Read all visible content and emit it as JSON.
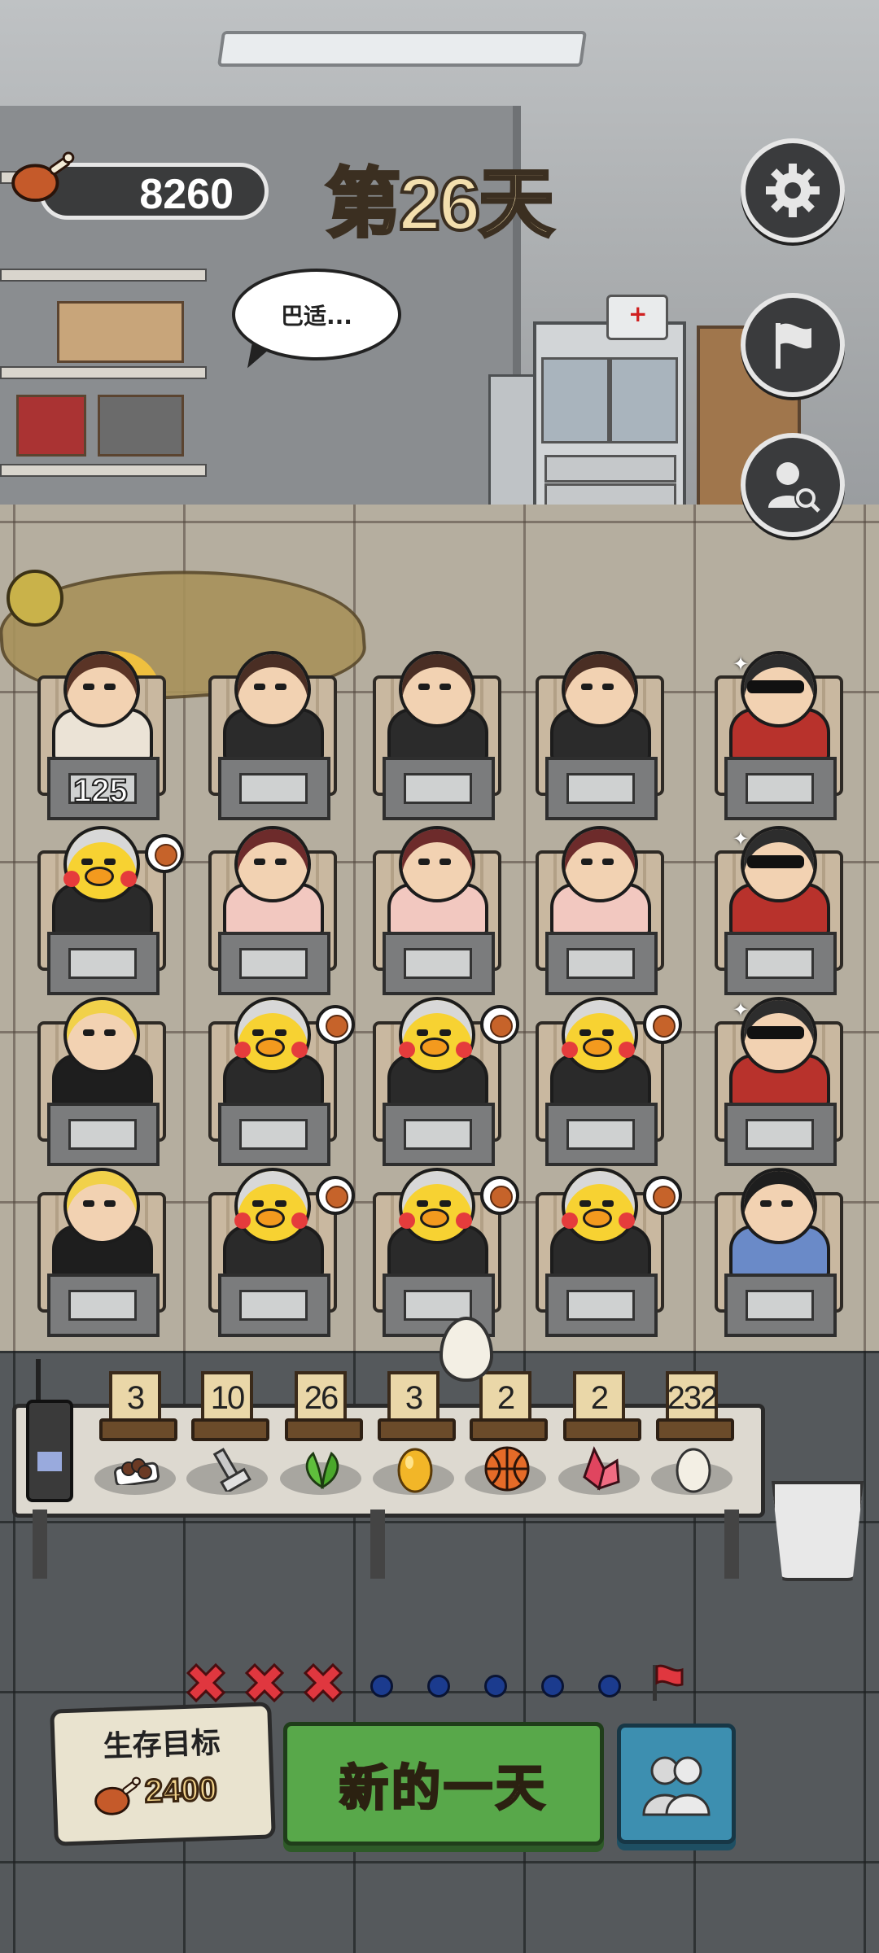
{
  "hud": {
    "food_count": "8260",
    "day_label": "第26天",
    "speech_text": "巴适..."
  },
  "side_buttons": [
    "gear-icon",
    "flag-icon",
    "profile-search-icon"
  ],
  "students": {
    "first_student_value": "125",
    "rows": [
      [
        "survivor-girl",
        "ponytail-girl",
        "ponytail-girl",
        "ponytail-girl",
        "sunglasses-guy"
      ],
      [
        "chicken-mask",
        "hooded-girl",
        "hooded-girl",
        "hooded-girl",
        "sunglasses-guy"
      ],
      [
        "vampire-boy",
        "chicken-mask",
        "chicken-mask",
        "chicken-mask",
        "sunglasses-guy"
      ],
      [
        "vampire-boy",
        "chicken-mask",
        "chicken-mask",
        "chicken-mask",
        "basketball-boy"
      ]
    ]
  },
  "items": [
    {
      "name": "beans",
      "icon": "beans-icon",
      "count": "3"
    },
    {
      "name": "bolt",
      "icon": "bolt-icon",
      "count": "10"
    },
    {
      "name": "herb",
      "icon": "herb-icon",
      "count": "26"
    },
    {
      "name": "golden-egg",
      "icon": "golden-egg-icon",
      "count": "3"
    },
    {
      "name": "basketball",
      "icon": "basketball-icon",
      "count": "2"
    },
    {
      "name": "crystal",
      "icon": "crystal-icon",
      "count": "2"
    },
    {
      "name": "egg",
      "icon": "egg-icon",
      "count": "232"
    }
  ],
  "progress": {
    "failed_days": 3,
    "pending_days": 5,
    "end_marker": "flag-icon"
  },
  "goal": {
    "title": "生存目标",
    "value": "2400"
  },
  "new_day_button": {
    "label": "新的一天"
  },
  "colors": {
    "accent_green": "#58a84a",
    "accent_blue": "#3d8fb0",
    "day_text": "#f3dfae",
    "fail_red": "#e0373f"
  }
}
